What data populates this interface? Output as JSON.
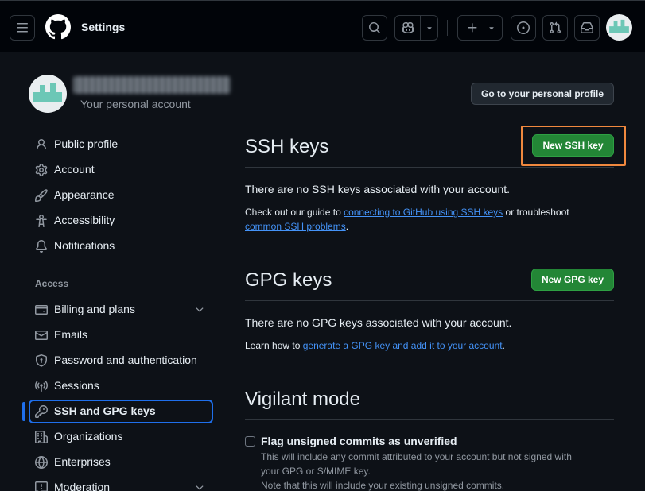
{
  "header": {
    "title": "Settings",
    "icons": [
      "menu-icon",
      "github-logo",
      "search-icon",
      "copilot-icon",
      "triangle-down-icon",
      "plus-icon",
      "issue-icon",
      "pull-request-icon",
      "inbox-icon"
    ]
  },
  "account": {
    "subtitle": "Your personal account",
    "profile_button": "Go to your personal profile"
  },
  "sidebar": {
    "items": [
      {
        "label": "Public profile",
        "icon": "person-icon"
      },
      {
        "label": "Account",
        "icon": "gear-icon"
      },
      {
        "label": "Appearance",
        "icon": "paintbrush-icon"
      },
      {
        "label": "Accessibility",
        "icon": "accessibility-icon"
      },
      {
        "label": "Notifications",
        "icon": "bell-icon"
      }
    ],
    "access_heading": "Access",
    "access_items": [
      {
        "label": "Billing and plans",
        "icon": "credit-card-icon"
      },
      {
        "label": "Emails",
        "icon": "mail-icon"
      },
      {
        "label": "Password and authentication",
        "icon": "shield-lock-icon"
      },
      {
        "label": "Sessions",
        "icon": "broadcast-icon"
      },
      {
        "label": "SSH and GPG keys",
        "icon": "key-icon",
        "selected": true
      },
      {
        "label": "Organizations",
        "icon": "organization-icon"
      },
      {
        "label": "Enterprises",
        "icon": "globe-icon"
      },
      {
        "label": "Moderation",
        "icon": "report-icon"
      }
    ]
  },
  "ssh": {
    "title": "SSH keys",
    "new_button": "New SSH key",
    "empty_text": "There are no SSH keys associated with your account.",
    "guide_prefix": "Check out our guide to ",
    "guide_link": "connecting to GitHub using SSH keys",
    "guide_mid": " or troubleshoot ",
    "guide_link2": "common SSH problems",
    "guide_suffix": "."
  },
  "gpg": {
    "title": "GPG keys",
    "new_button": "New GPG key",
    "empty_text": "There are no GPG keys associated with your account.",
    "learn_prefix": "Learn how to ",
    "learn_link": "generate a GPG key and add it to your account",
    "learn_suffix": "."
  },
  "vigilant": {
    "title": "Vigilant mode",
    "checkbox_label": "Flag unsigned commits as unverified",
    "desc_line1": "This will include any commit attributed to your account but not signed with",
    "desc_line2": "your GPG or S/MIME key.",
    "desc_line3": "Note that this will include your existing unsigned commits."
  },
  "colors": {
    "accent": "#1f6feb",
    "green": "#238636",
    "link": "#4493f8",
    "highlight": "#f0883e"
  }
}
